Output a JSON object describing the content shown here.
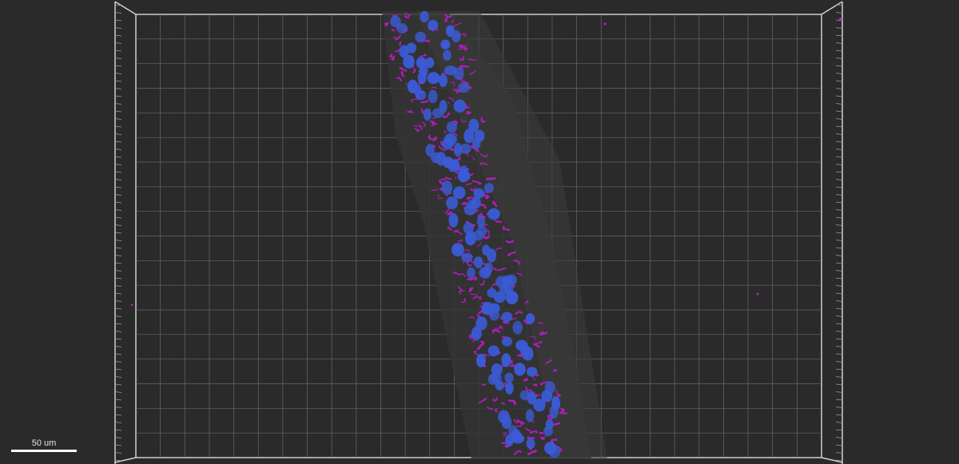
{
  "viewer": {
    "background_color": "#2a2a2a",
    "grid_color": "#8a8a8a",
    "nuclei_color": "#3b5bd6",
    "membrane_color": "#c21ad0",
    "tissue_color": "#3a3a3a"
  },
  "scale_bar": {
    "label": "50 um"
  }
}
